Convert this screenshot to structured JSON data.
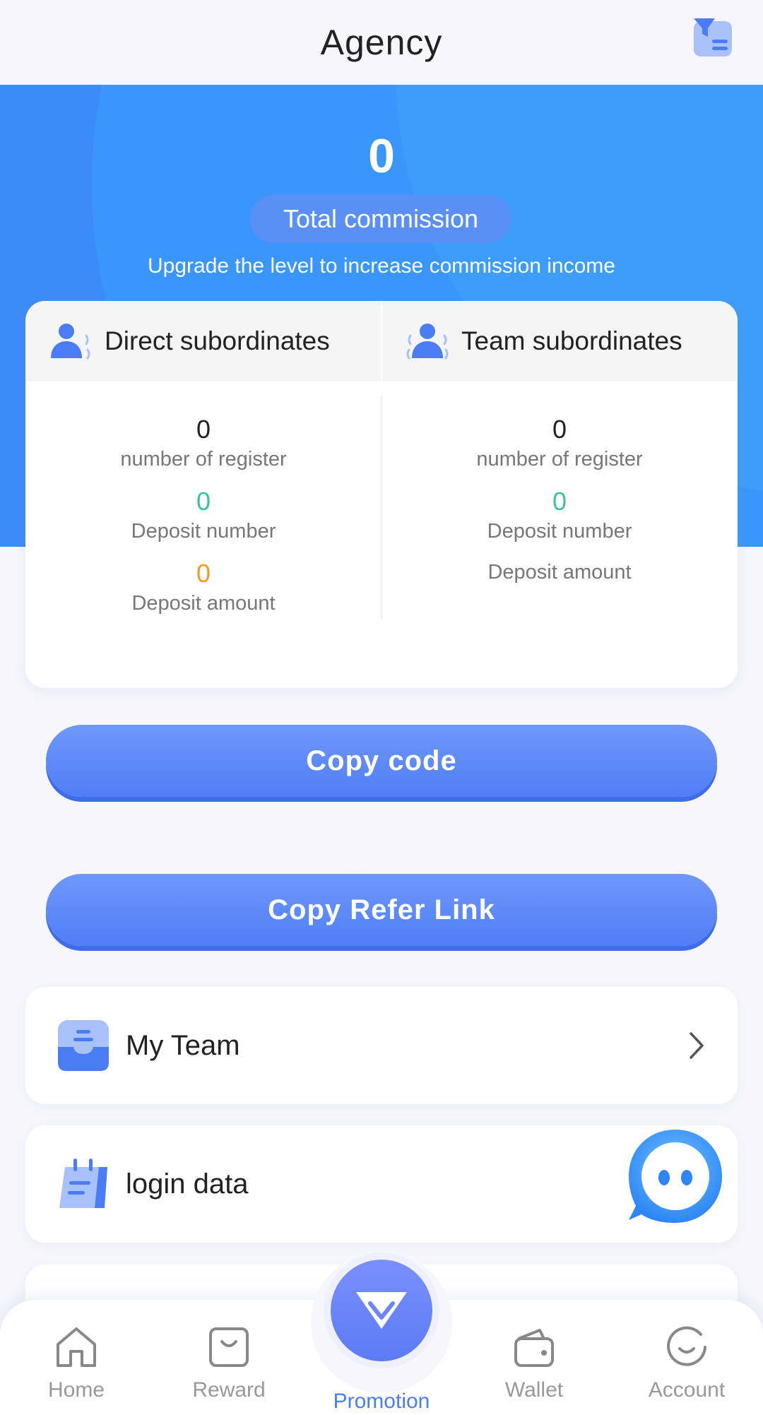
{
  "header": {
    "title": "Agency",
    "action_icon": "filter-list-icon"
  },
  "hero": {
    "commission_value": "0",
    "commission_label": "Total commission",
    "note": "Upgrade the level to increase commission income"
  },
  "stats": {
    "direct": {
      "title": "Direct subordinates",
      "register_value": "0",
      "register_label": "number of register",
      "deposit_number_value": "0",
      "deposit_number_label": "Deposit number",
      "deposit_amount_value": "0",
      "deposit_amount_label": "Deposit amount"
    },
    "team": {
      "title": "Team subordinates",
      "register_value": "0",
      "register_label": "number of register",
      "deposit_number_value": "0",
      "deposit_number_label": "Deposit number",
      "deposit_amount_label": "Deposit amount"
    }
  },
  "buttons": {
    "copy_code": "Copy code",
    "copy_link": "Copy Refer Link"
  },
  "menu": [
    {
      "label": "My Team",
      "icon": "inbox-icon"
    },
    {
      "label": "login data",
      "icon": "calendar-icon"
    }
  ],
  "nav": {
    "home": "Home",
    "reward": "Reward",
    "promotion": "Promotion",
    "wallet": "Wallet",
    "account": "Account"
  },
  "colors": {
    "accent": "#4a7cf5",
    "hero_bg": "#3d8bfa",
    "green": "#3cc49a",
    "orange": "#f39a2a"
  }
}
